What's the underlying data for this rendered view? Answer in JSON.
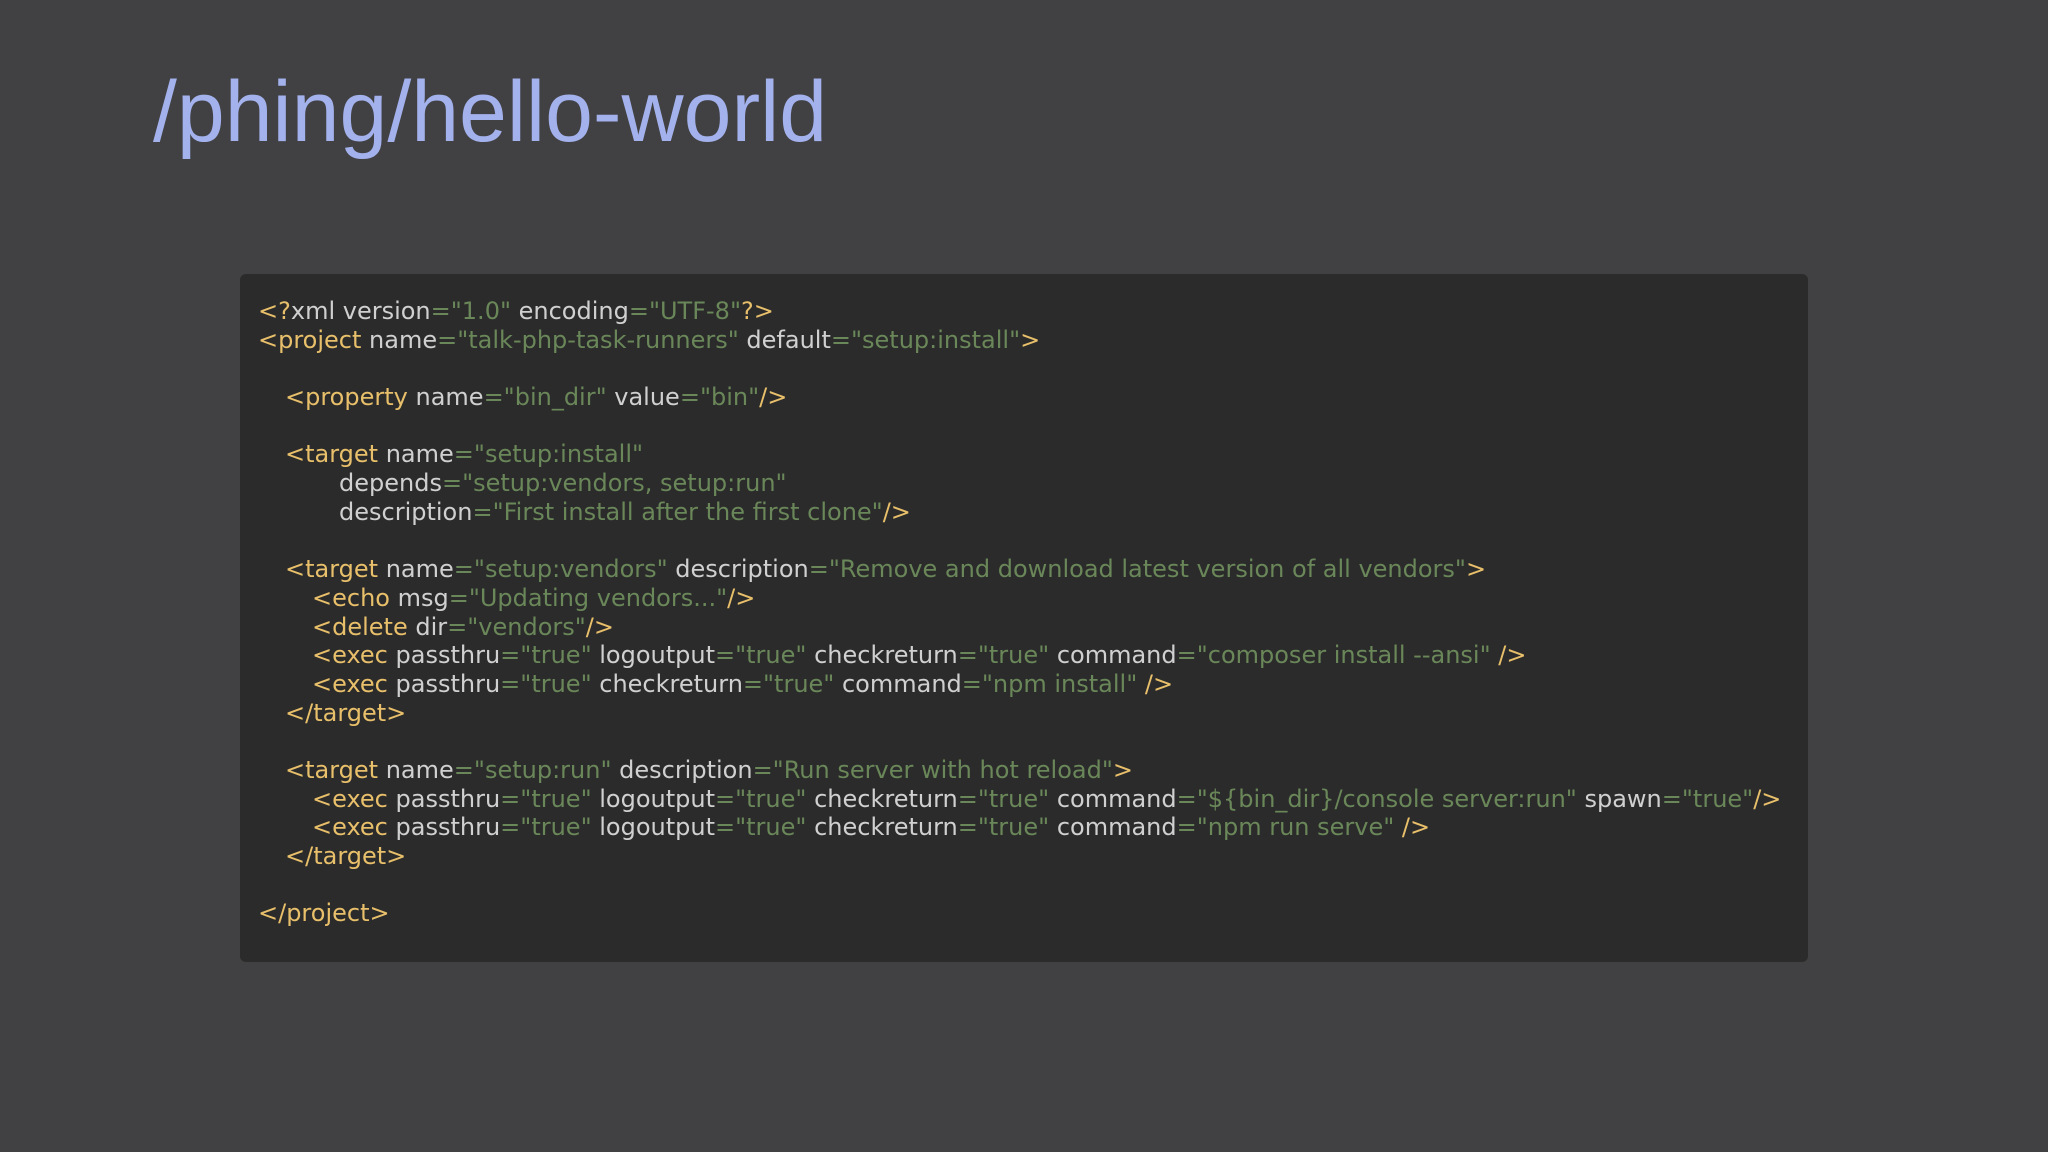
{
  "slide": {
    "title": "/phing/hello-world"
  },
  "colors": {
    "background": "#414143",
    "title": "#a3b1ec",
    "code_background": "#2b2b2b",
    "tag": "#e8bf6a",
    "attribute": "#d0d0d0",
    "string": "#6a8759"
  },
  "code": {
    "language": "xml",
    "lines": [
      {
        "indent": 0,
        "tokens": [
          {
            "t": "tag",
            "v": "<?"
          },
          {
            "t": "attr",
            "v": "xml version"
          },
          {
            "t": "eq",
            "v": "="
          },
          {
            "t": "val",
            "v": "\"1.0\""
          },
          {
            "t": "attr",
            "v": " encoding"
          },
          {
            "t": "eq",
            "v": "="
          },
          {
            "t": "val",
            "v": "\"UTF-8\""
          },
          {
            "t": "tag",
            "v": "?>"
          }
        ]
      },
      {
        "indent": 0,
        "tokens": [
          {
            "t": "tag",
            "v": "<project"
          },
          {
            "t": "attr",
            "v": " name"
          },
          {
            "t": "eq",
            "v": "="
          },
          {
            "t": "val",
            "v": "\"talk-php-task-runners\""
          },
          {
            "t": "attr",
            "v": " default"
          },
          {
            "t": "eq",
            "v": "="
          },
          {
            "t": "val",
            "v": "\"setup:install\""
          },
          {
            "t": "tag",
            "v": ">"
          }
        ]
      },
      {
        "indent": 0,
        "tokens": []
      },
      {
        "indent": 1,
        "tokens": [
          {
            "t": "tag",
            "v": "<property"
          },
          {
            "t": "attr",
            "v": " name"
          },
          {
            "t": "eq",
            "v": "="
          },
          {
            "t": "val",
            "v": "\"bin_dir\""
          },
          {
            "t": "attr",
            "v": " value"
          },
          {
            "t": "eq",
            "v": "="
          },
          {
            "t": "val",
            "v": "\"bin\""
          },
          {
            "t": "tag",
            "v": "/>"
          }
        ]
      },
      {
        "indent": 0,
        "tokens": []
      },
      {
        "indent": 1,
        "tokens": [
          {
            "t": "tag",
            "v": "<target"
          },
          {
            "t": "attr",
            "v": " name"
          },
          {
            "t": "eq",
            "v": "="
          },
          {
            "t": "val",
            "v": "\"setup:install\""
          }
        ]
      },
      {
        "indent": 3,
        "tokens": [
          {
            "t": "attr",
            "v": "depends"
          },
          {
            "t": "eq",
            "v": "="
          },
          {
            "t": "val",
            "v": "\"setup:vendors, setup:run\""
          }
        ]
      },
      {
        "indent": 3,
        "tokens": [
          {
            "t": "attr",
            "v": "description"
          },
          {
            "t": "eq",
            "v": "="
          },
          {
            "t": "val",
            "v": "\"First install after the first clone\""
          },
          {
            "t": "tag",
            "v": "/>"
          }
        ]
      },
      {
        "indent": 0,
        "tokens": []
      },
      {
        "indent": 1,
        "tokens": [
          {
            "t": "tag",
            "v": "<target"
          },
          {
            "t": "attr",
            "v": " name"
          },
          {
            "t": "eq",
            "v": "="
          },
          {
            "t": "val",
            "v": "\"setup:vendors\""
          },
          {
            "t": "attr",
            "v": " description"
          },
          {
            "t": "eq",
            "v": "="
          },
          {
            "t": "val",
            "v": "\"Remove and download latest version of all vendors\""
          },
          {
            "t": "tag",
            "v": ">"
          }
        ]
      },
      {
        "indent": 2,
        "tokens": [
          {
            "t": "tag",
            "v": "<echo"
          },
          {
            "t": "attr",
            "v": " msg"
          },
          {
            "t": "eq",
            "v": "="
          },
          {
            "t": "val",
            "v": "\"Updating vendors...\""
          },
          {
            "t": "tag",
            "v": "/>"
          }
        ]
      },
      {
        "indent": 2,
        "tokens": [
          {
            "t": "tag",
            "v": "<delete"
          },
          {
            "t": "attr",
            "v": " dir"
          },
          {
            "t": "eq",
            "v": "="
          },
          {
            "t": "val",
            "v": "\"vendors\""
          },
          {
            "t": "tag",
            "v": "/>"
          }
        ]
      },
      {
        "indent": 2,
        "tokens": [
          {
            "t": "tag",
            "v": "<exec"
          },
          {
            "t": "attr",
            "v": " passthru"
          },
          {
            "t": "eq",
            "v": "="
          },
          {
            "t": "val",
            "v": "\"true\""
          },
          {
            "t": "attr",
            "v": " logoutput"
          },
          {
            "t": "eq",
            "v": "="
          },
          {
            "t": "val",
            "v": "\"true\""
          },
          {
            "t": "attr",
            "v": " checkreturn"
          },
          {
            "t": "eq",
            "v": "="
          },
          {
            "t": "val",
            "v": "\"true\""
          },
          {
            "t": "attr",
            "v": " command"
          },
          {
            "t": "eq",
            "v": "="
          },
          {
            "t": "val",
            "v": "\"composer install --ansi\""
          },
          {
            "t": "tag",
            "v": " />"
          }
        ]
      },
      {
        "indent": 2,
        "tokens": [
          {
            "t": "tag",
            "v": "<exec"
          },
          {
            "t": "attr",
            "v": " passthru"
          },
          {
            "t": "eq",
            "v": "="
          },
          {
            "t": "val",
            "v": "\"true\""
          },
          {
            "t": "attr",
            "v": " checkreturn"
          },
          {
            "t": "eq",
            "v": "="
          },
          {
            "t": "val",
            "v": "\"true\""
          },
          {
            "t": "attr",
            "v": " command"
          },
          {
            "t": "eq",
            "v": "="
          },
          {
            "t": "val",
            "v": "\"npm install\""
          },
          {
            "t": "tag",
            "v": " />"
          }
        ]
      },
      {
        "indent": 1,
        "tokens": [
          {
            "t": "tag",
            "v": "</target>"
          }
        ]
      },
      {
        "indent": 0,
        "tokens": []
      },
      {
        "indent": 1,
        "tokens": [
          {
            "t": "tag",
            "v": "<target"
          },
          {
            "t": "attr",
            "v": " name"
          },
          {
            "t": "eq",
            "v": "="
          },
          {
            "t": "val",
            "v": "\"setup:run\""
          },
          {
            "t": "attr",
            "v": " description"
          },
          {
            "t": "eq",
            "v": "="
          },
          {
            "t": "val",
            "v": "\"Run server with hot reload\""
          },
          {
            "t": "tag",
            "v": ">"
          }
        ]
      },
      {
        "indent": 2,
        "tokens": [
          {
            "t": "tag",
            "v": "<exec"
          },
          {
            "t": "attr",
            "v": " passthru"
          },
          {
            "t": "eq",
            "v": "="
          },
          {
            "t": "val",
            "v": "\"true\""
          },
          {
            "t": "attr",
            "v": " logoutput"
          },
          {
            "t": "eq",
            "v": "="
          },
          {
            "t": "val",
            "v": "\"true\""
          },
          {
            "t": "attr",
            "v": " checkreturn"
          },
          {
            "t": "eq",
            "v": "="
          },
          {
            "t": "val",
            "v": "\"true\""
          },
          {
            "t": "attr",
            "v": " command"
          },
          {
            "t": "eq",
            "v": "="
          },
          {
            "t": "val",
            "v": "\"${bin_dir}/console server:run\""
          },
          {
            "t": "attr",
            "v": " spawn"
          },
          {
            "t": "eq",
            "v": "="
          },
          {
            "t": "val",
            "v": "\"true\""
          },
          {
            "t": "tag",
            "v": "/>"
          }
        ]
      },
      {
        "indent": 2,
        "tokens": [
          {
            "t": "tag",
            "v": "<exec"
          },
          {
            "t": "attr",
            "v": " passthru"
          },
          {
            "t": "eq",
            "v": "="
          },
          {
            "t": "val",
            "v": "\"true\""
          },
          {
            "t": "attr",
            "v": " logoutput"
          },
          {
            "t": "eq",
            "v": "="
          },
          {
            "t": "val",
            "v": "\"true\""
          },
          {
            "t": "attr",
            "v": " checkreturn"
          },
          {
            "t": "eq",
            "v": "="
          },
          {
            "t": "val",
            "v": "\"true\""
          },
          {
            "t": "attr",
            "v": " command"
          },
          {
            "t": "eq",
            "v": "="
          },
          {
            "t": "val",
            "v": "\"npm run serve\""
          },
          {
            "t": "tag",
            "v": " />"
          }
        ]
      },
      {
        "indent": 1,
        "tokens": [
          {
            "t": "tag",
            "v": "</target>"
          }
        ]
      },
      {
        "indent": 0,
        "tokens": []
      },
      {
        "indent": 0,
        "tokens": [
          {
            "t": "tag",
            "v": "</project>"
          }
        ]
      }
    ]
  }
}
